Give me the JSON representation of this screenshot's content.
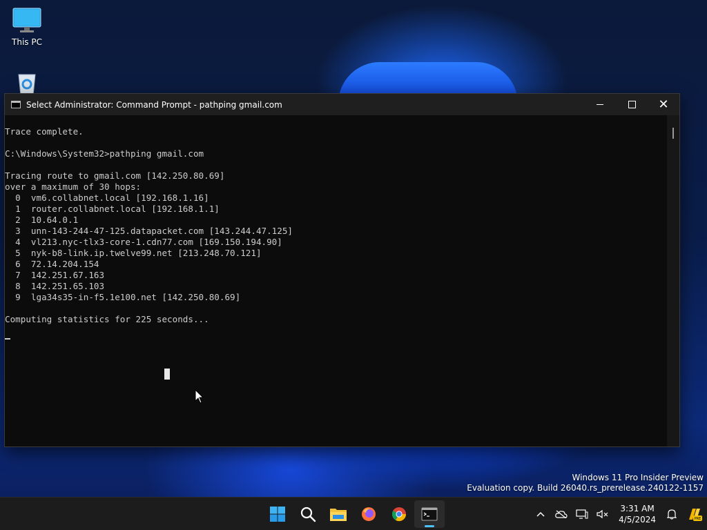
{
  "desktop": {
    "icons": [
      {
        "label": "This PC",
        "icon": "computer-icon"
      },
      {
        "label": "",
        "icon": "recycle-bin-icon"
      }
    ],
    "watermark": {
      "line1": "Windows 11 Pro Insider Preview",
      "line2": "Evaluation copy. Build 26040.rs_prerelease.240122-1157"
    }
  },
  "window": {
    "title": "Select Administrator: Command Prompt - pathping  gmail.com",
    "close_label": "✕",
    "console_lines": [
      "Trace complete.",
      "",
      "C:\\Windows\\System32>pathping gmail.com",
      "",
      "Tracing route to gmail.com [142.250.80.69]",
      "over a maximum of 30 hops:",
      "  0  vm6.collabnet.local [192.168.1.16]",
      "  1  router.collabnet.local [192.168.1.1]",
      "  2  10.64.0.1",
      "  3  unn-143-244-47-125.datapacket.com [143.244.47.125]",
      "  4  vl213.nyc-tlx3-core-1.cdn77.com [169.150.194.90]",
      "  5  nyk-b8-link.ip.twelve99.net [213.248.70.121]",
      "  6  72.14.204.154",
      "  7  142.251.67.163",
      "  8  142.251.65.103",
      "  9  lga34s35-in-f5.1e100.net [142.250.80.69]",
      "",
      "Computing statistics for 225 seconds..."
    ]
  },
  "taskbar": {
    "apps": [
      "start-icon",
      "search-icon",
      "file-explorer-icon",
      "firefox-icon",
      "chrome-icon",
      "terminal-icon"
    ],
    "active_app": "terminal-icon",
    "clock": {
      "time": "3:31 AM",
      "date": "4/5/2024"
    },
    "colors": {
      "accent": "#4cc2ff",
      "taskbar_bg": "#1c1c1c"
    }
  }
}
